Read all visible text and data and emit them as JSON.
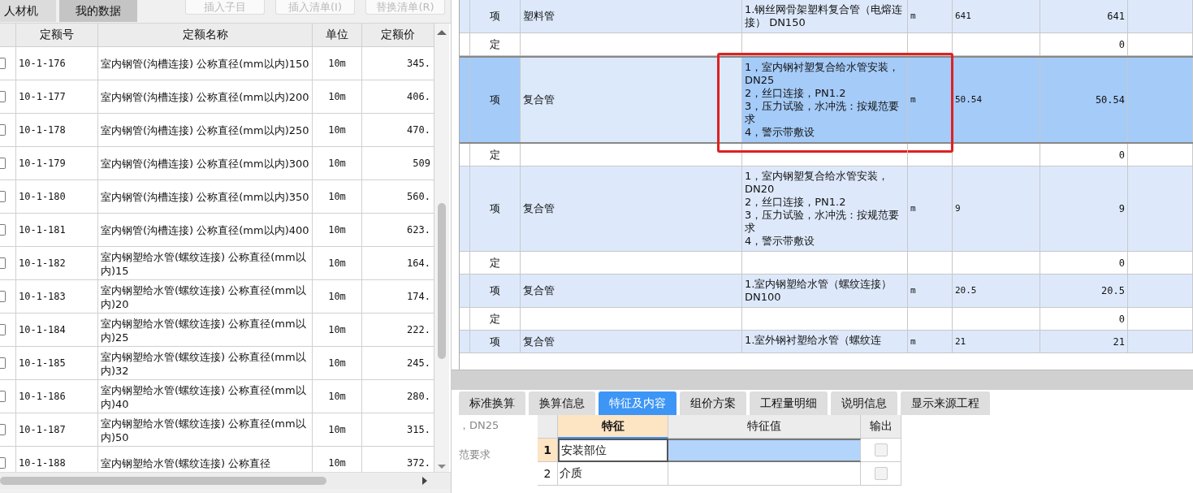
{
  "left_panel": {
    "tabs": [
      {
        "label": "人材机",
        "selected": false
      },
      {
        "label": "我的数据",
        "selected": true
      }
    ],
    "buttons": [
      {
        "label": "插入子目",
        "disabled": true
      },
      {
        "label": "插入清单(I)",
        "disabled": true
      },
      {
        "label": "替换清单(R)",
        "disabled": true
      }
    ],
    "table": {
      "columns": [
        "定额号",
        "定额名称",
        "单位",
        "定额价"
      ],
      "rows": [
        {
          "checked": false,
          "code": "10-1-176",
          "name": "室内钢管(沟槽连接) 公称直径(mm以内)150",
          "unit": "10m",
          "price": "345."
        },
        {
          "checked": false,
          "code": "10-1-177",
          "name": "室内钢管(沟槽连接) 公称直径(mm以内)200",
          "unit": "10m",
          "price": "406."
        },
        {
          "checked": false,
          "code": "10-1-178",
          "name": "室内钢管(沟槽连接) 公称直径(mm以内)250",
          "unit": "10m",
          "price": "470."
        },
        {
          "checked": false,
          "code": "10-1-179",
          "name": "室内钢管(沟槽连接) 公称直径(mm以内)300",
          "unit": "10m",
          "price": "509"
        },
        {
          "checked": false,
          "code": "10-1-180",
          "name": "室内钢管(沟槽连接) 公称直径(mm以内)350",
          "unit": "10m",
          "price": "560."
        },
        {
          "checked": false,
          "code": "10-1-181",
          "name": "室内钢管(沟槽连接) 公称直径(mm以内)400",
          "unit": "10m",
          "price": "623."
        },
        {
          "checked": false,
          "code": "10-1-182",
          "name": "室内钢塑给水管(螺纹连接) 公称直径(mm以内)15",
          "unit": "10m",
          "price": "164."
        },
        {
          "checked": false,
          "code": "10-1-183",
          "name": "室内钢塑给水管(螺纹连接) 公称直径(mm以内)20",
          "unit": "10m",
          "price": "174."
        },
        {
          "checked": false,
          "code": "10-1-184",
          "name": "室内钢塑给水管(螺纹连接) 公称直径(mm以内)25",
          "unit": "10m",
          "price": "222."
        },
        {
          "checked": false,
          "code": "10-1-185",
          "name": "室内钢塑给水管(螺纹连接) 公称直径(mm以内)32",
          "unit": "10m",
          "price": "245."
        },
        {
          "checked": false,
          "code": "10-1-186",
          "name": "室内钢塑给水管(螺纹连接) 公称直径(mm以内)40",
          "unit": "10m",
          "price": "280."
        },
        {
          "checked": false,
          "code": "10-1-187",
          "name": "室内钢塑给水管(螺纹连接) 公称直径(mm以内)50",
          "unit": "10m",
          "price": "315."
        },
        {
          "checked": false,
          "code": "10-1-188",
          "name": "室内钢塑给水管(螺纹连接) 公称直径",
          "unit": "10m",
          "price": "372."
        }
      ]
    }
  },
  "bill_table": {
    "rows": [
      {
        "kind": "item",
        "selected": false,
        "highlighted": false,
        "type": "项",
        "name": "塑料管",
        "features": "1.钢丝网骨架塑料复合管（电熔连接） DN150",
        "unit": "m",
        "quantity": "641",
        "amount": "641"
      },
      {
        "kind": "quota",
        "selected": false,
        "highlighted": false,
        "type": "定",
        "amount": "0"
      },
      {
        "kind": "item",
        "selected": true,
        "highlighted": true,
        "type": "项",
        "name": "复合管",
        "features": "1，室内钢衬塑复合给水管安装，DN25\n2，丝口连接，PN1.2\n3，压力试验，水冲洗：按规范要求\n4，警示带敷设",
        "unit": "m",
        "quantity": "50.54",
        "amount": "50.54"
      },
      {
        "kind": "quota",
        "selected": false,
        "highlighted": false,
        "type": "定",
        "amount": "0"
      },
      {
        "kind": "item",
        "selected": false,
        "highlighted": false,
        "type": "项",
        "name": "复合管",
        "features": "1，室内钢塑复合给水管安装，DN20\n2，丝口连接，PN1.2\n3，压力试验，水冲洗：按规范要求\n4，警示带敷设",
        "unit": "m",
        "quantity": "9",
        "amount": "9"
      },
      {
        "kind": "quota",
        "selected": false,
        "highlighted": false,
        "type": "定",
        "amount": "0"
      },
      {
        "kind": "item",
        "selected": false,
        "highlighted": false,
        "type": "项",
        "name": "复合管",
        "features": "1.室内钢塑给水管（螺纹连接） DN100",
        "unit": "m",
        "quantity": "20.5",
        "amount": "20.5"
      },
      {
        "kind": "quota",
        "selected": false,
        "highlighted": false,
        "type": "定",
        "amount": "0"
      },
      {
        "kind": "item",
        "selected": false,
        "highlighted": false,
        "type": "项",
        "name": "复合管",
        "features": "1.室外钢衬塑给水管（螺纹连",
        "unit": "m",
        "quantity": "21",
        "amount": "21"
      }
    ]
  },
  "detail_tabs": [
    {
      "label": "标准换算",
      "selected": false
    },
    {
      "label": "换算信息",
      "selected": false
    },
    {
      "label": "特征及内容",
      "selected": true
    },
    {
      "label": "组价方案",
      "selected": false
    },
    {
      "label": "工程量明细",
      "selected": false
    },
    {
      "label": "说明信息",
      "selected": false
    },
    {
      "label": "显示来源工程",
      "selected": false
    }
  ],
  "description_preview": [
    "，DN25",
    "范要求"
  ],
  "feature_table": {
    "columns": [
      "特征",
      "特征值",
      "输出"
    ],
    "rows": [
      {
        "index": "1",
        "feature": "安装部位",
        "selected": true,
        "output": false
      },
      {
        "index": "2",
        "feature": "介质",
        "selected": false,
        "output": false
      }
    ]
  }
}
